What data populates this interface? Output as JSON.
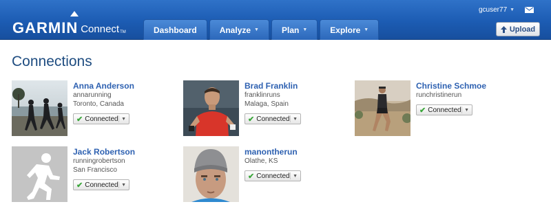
{
  "header": {
    "logo_brand": "GARMIN",
    "logo_product": "Connect",
    "logo_tm": "TM",
    "nav": [
      {
        "label": "Dashboard",
        "has_menu": false
      },
      {
        "label": "Analyze",
        "has_menu": true
      },
      {
        "label": "Plan",
        "has_menu": true
      },
      {
        "label": "Explore",
        "has_menu": true
      }
    ],
    "username": "gcuser77",
    "upload_label": "Upload",
    "colors": {
      "bar": "#1c5cb3",
      "tab": "#2c68bb"
    }
  },
  "page": {
    "title": "Connections"
  },
  "connections": [
    {
      "name": "Anna Anderson",
      "username": "annarunning",
      "location": "Toronto, Canada",
      "status": "Connected",
      "photo": "runners-by-water-photo"
    },
    {
      "name": "Brad Franklin",
      "username": "franklinruns",
      "location": "Malaga, Spain",
      "status": "Connected",
      "photo": "runner-red-shirt-photo"
    },
    {
      "name": "Christine Schmoe",
      "username": "runchristinerun",
      "location": "",
      "status": "Connected",
      "photo": "trail-runner-photo"
    },
    {
      "name": "Jack Robertson",
      "username": "runningrobertson",
      "location": "San Francisco",
      "status": "Connected",
      "photo": "default-runner-silhouette"
    },
    {
      "name": "manontherun",
      "username": "",
      "location": "Olathe, KS",
      "status": "Connected",
      "photo": "man-in-beanie-photo"
    }
  ]
}
